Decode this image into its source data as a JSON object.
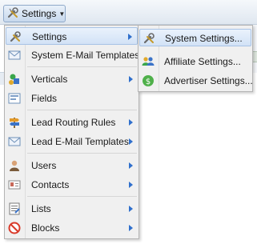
{
  "toolbar": {
    "settings_label": "Settings",
    "settings_icon": "wrench-screwdriver-icon"
  },
  "menu": {
    "items": [
      {
        "label": "Settings",
        "icon": "wrench-screwdriver-icon",
        "has_submenu": true,
        "active": true
      },
      {
        "label": "System E-Mail Templates",
        "icon": "envelope-icon",
        "has_submenu": false
      },
      {
        "label": "Verticals",
        "icon": "shapes-icon",
        "has_submenu": true
      },
      {
        "label": "Fields",
        "icon": "form-fields-icon",
        "has_submenu": false
      },
      {
        "label": "Lead Routing Rules",
        "icon": "routing-sign-icon",
        "has_submenu": true
      },
      {
        "label": "Lead E-Mail Templates",
        "icon": "envelope-icon",
        "has_submenu": true
      },
      {
        "label": "Users",
        "icon": "user-icon",
        "has_submenu": true
      },
      {
        "label": "Contacts",
        "icon": "address-card-icon",
        "has_submenu": true
      },
      {
        "label": "Lists",
        "icon": "checklist-icon",
        "has_submenu": true
      },
      {
        "label": "Blocks",
        "icon": "block-icon",
        "has_submenu": true
      }
    ]
  },
  "submenu": {
    "items": [
      {
        "label": "System Settings...",
        "icon": "wrench-screwdriver-icon",
        "active": true
      },
      {
        "label": "Affiliate Settings...",
        "icon": "users-group-icon"
      },
      {
        "label": "Advertiser Settings...",
        "icon": "dollar-coin-icon"
      }
    ]
  },
  "colors": {
    "highlight": "#d2e2f6",
    "highlight_border": "#a8c3e5",
    "submenu_arrow": "#2f6fcc",
    "menu_bg": "#f0f0f0"
  }
}
